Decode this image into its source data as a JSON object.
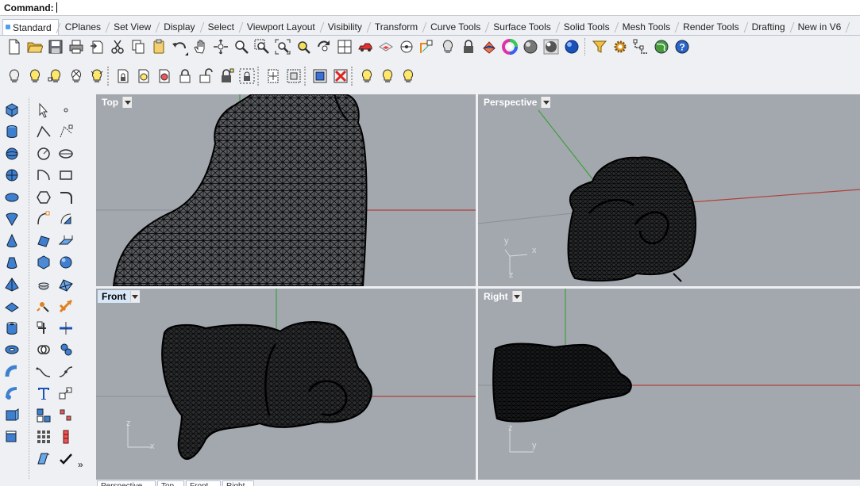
{
  "command": {
    "label": "Command:",
    "value": ""
  },
  "tabs": [
    "Standard",
    "CPlanes",
    "Set View",
    "Display",
    "Select",
    "Viewport Layout",
    "Visibility",
    "Transform",
    "Curve Tools",
    "Surface Tools",
    "Solid Tools",
    "Mesh Tools",
    "Render Tools",
    "Drafting",
    "New in V6"
  ],
  "active_tab": "Standard",
  "toolbar_row1_icons": [
    "new-file",
    "open-folder",
    "save",
    "print",
    "import",
    "cut",
    "copy",
    "paste",
    "undo",
    "pan-hand",
    "rotate-view",
    "zoom",
    "zoom-window",
    "zoom-extents",
    "zoom-selected",
    "rotate-camera",
    "four-viewports",
    "car-render",
    "layer-tools",
    "lens-tools",
    "snap-object",
    "lightbulb-hide",
    "lock",
    "material",
    "color-wheel",
    "shaded-sphere",
    "render-sphere",
    "rendered-sphere",
    "filter-select",
    "settings-gear",
    "gumball",
    "globe-tools",
    "help"
  ],
  "toolbar_row2_icons": [
    "show-objects",
    "hide-objects",
    "hide-swap",
    "show-selected",
    "hide-points",
    "lock-object",
    "unlock-object",
    "lock-swap",
    "lock",
    "unlock-selected",
    "padlock-open",
    "select-locked",
    "disable-isolate",
    "block-edit",
    "isolate",
    "delete-isolate",
    "light-on",
    "light-off",
    "light-all"
  ],
  "viewports": {
    "top": {
      "label": "Top"
    },
    "perspective": {
      "label": "Perspective"
    },
    "front": {
      "label": "Front"
    },
    "right": {
      "label": "Right"
    }
  },
  "axis_labels": {
    "x": "x",
    "y": "y",
    "z": "z"
  },
  "palette_more": "»",
  "bottom_tabs": [
    "Perspective",
    "Top",
    "Front",
    "Right"
  ],
  "colors": {
    "viewport_bg": "#a3a8ae",
    "x_axis": "#b0403a",
    "y_axis": "#3f9f3f",
    "mesh": "#0a0a0a",
    "active_title_bg": "#d8e7f7"
  }
}
